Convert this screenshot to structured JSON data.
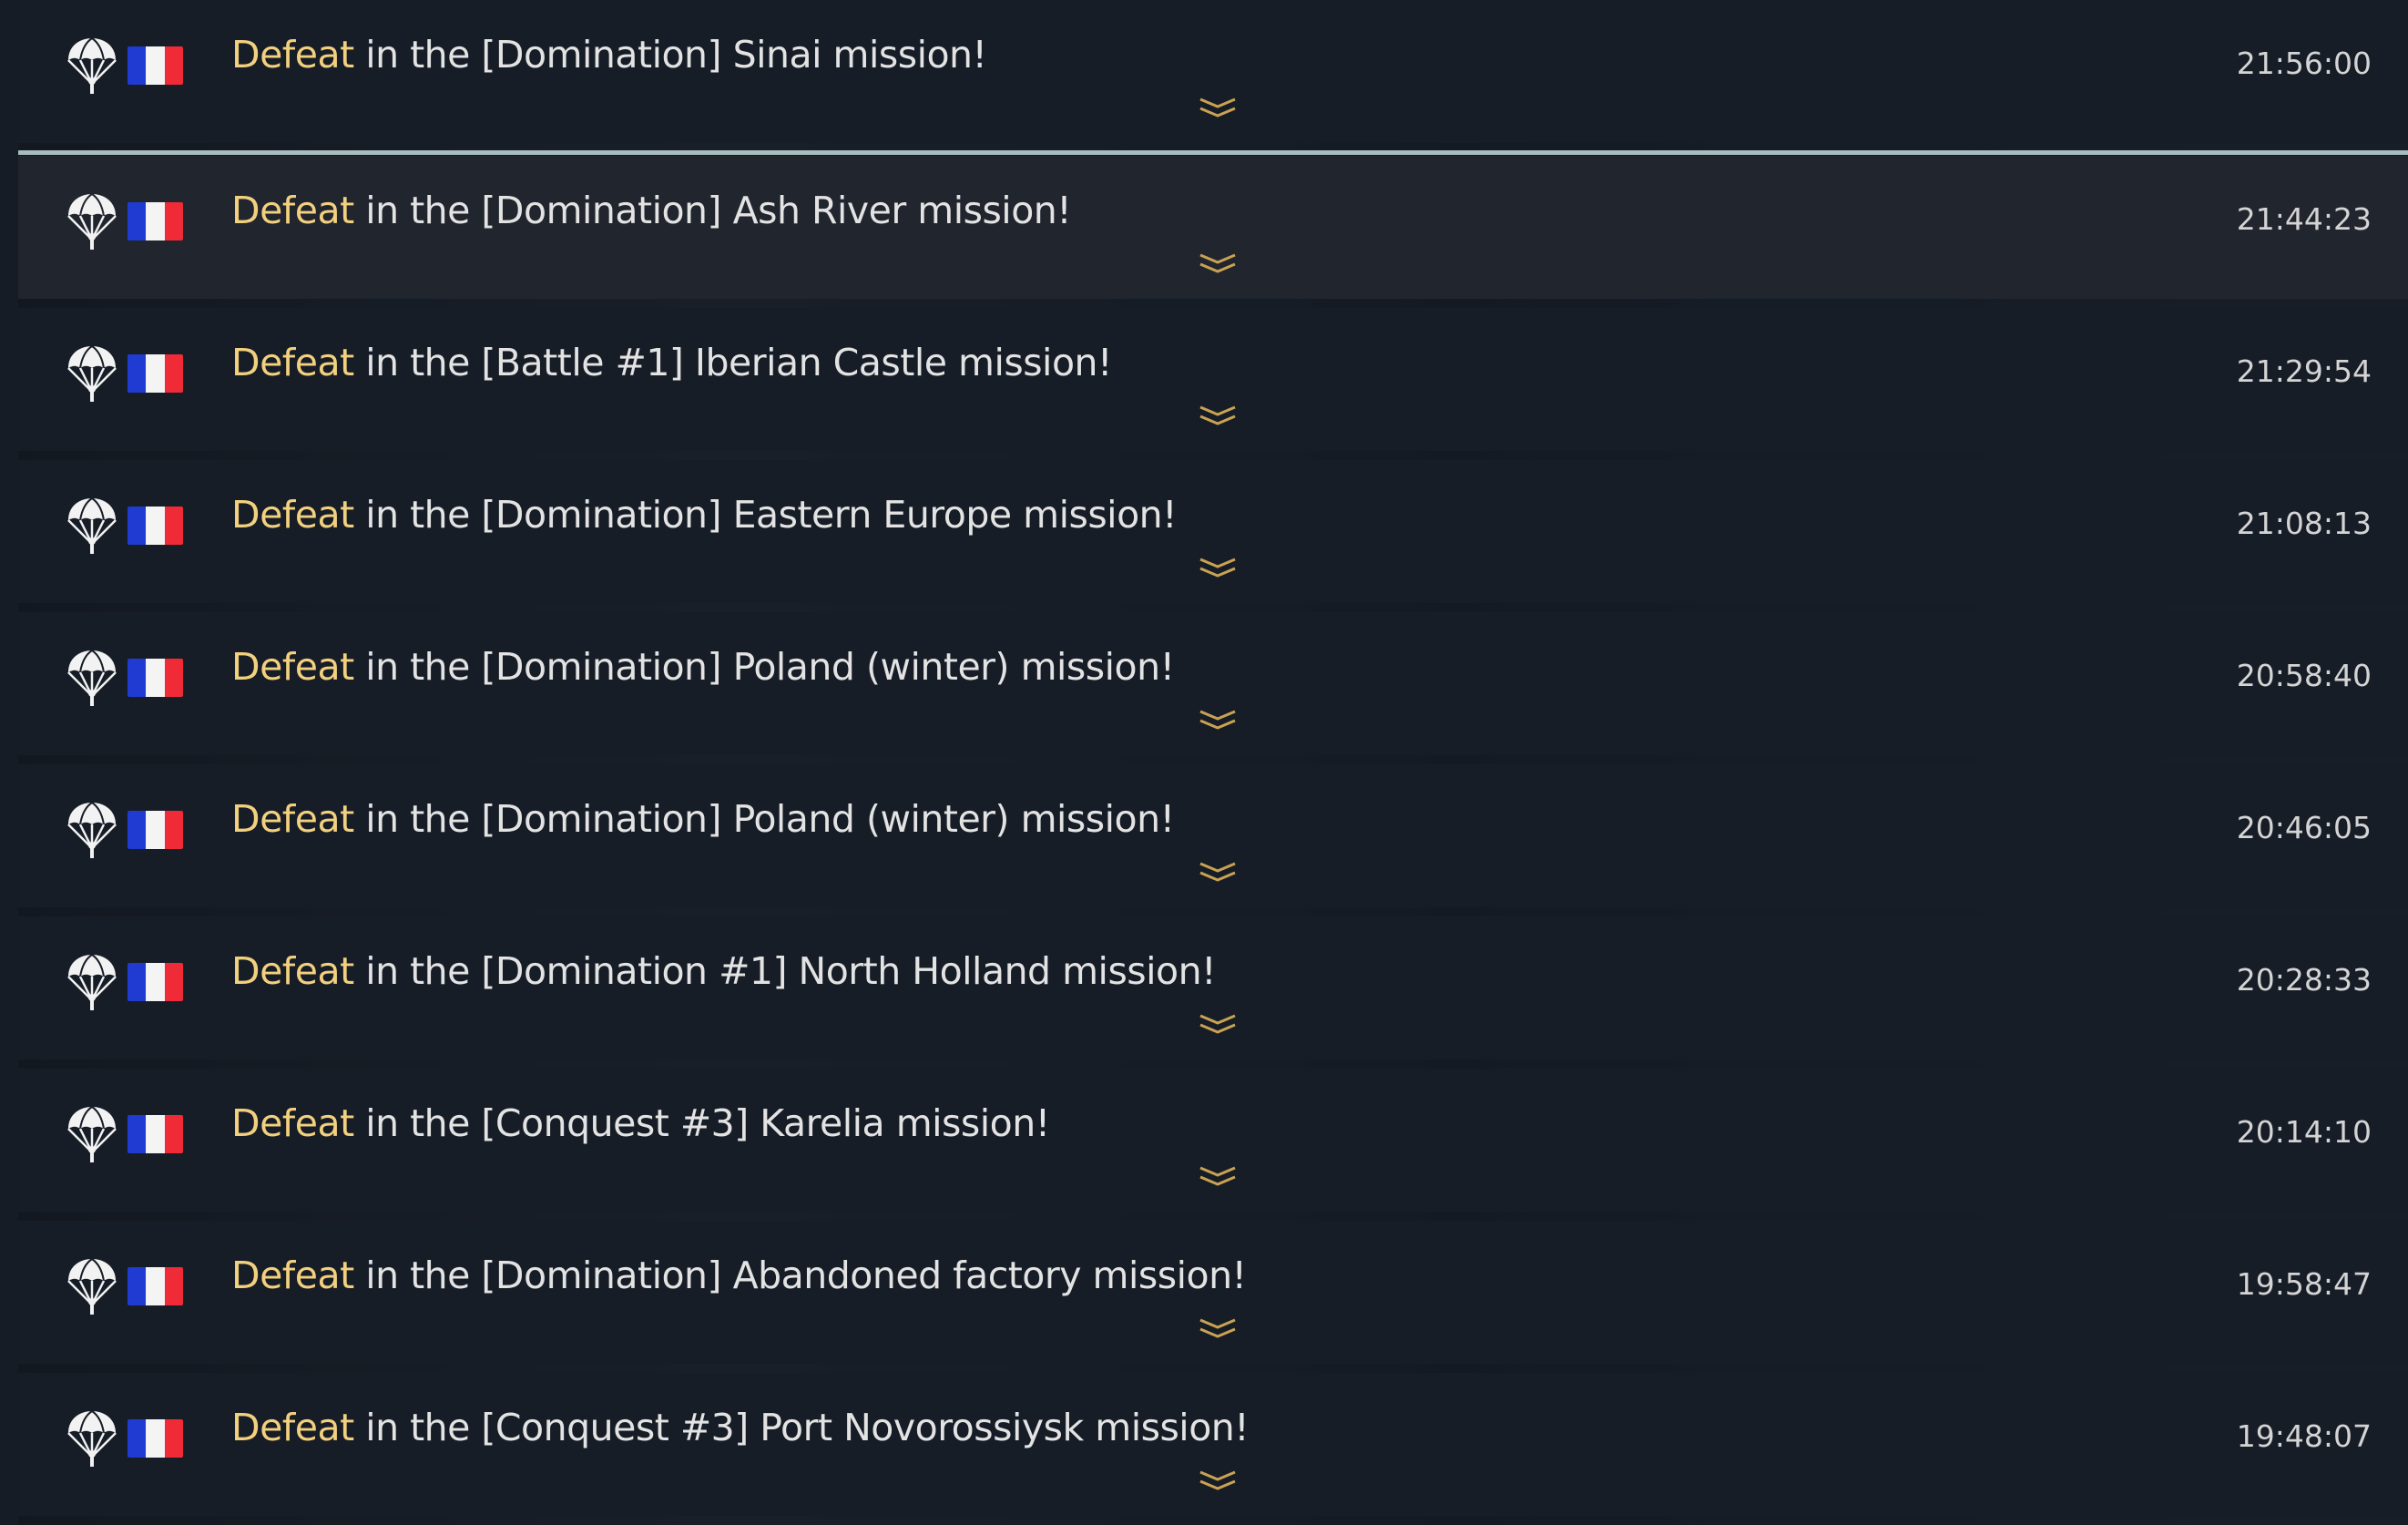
{
  "colors": {
    "background": "#161c26",
    "row_background": "#171d27",
    "selected_row_background": "#20252e",
    "selected_divider": "#a9bcbf",
    "result_text": "#f2d07e",
    "message_text": "#e3e3e3",
    "time_text": "#d4d4d4",
    "expand_chevron": "#c9a253",
    "flag_blue": "#1f3bd1",
    "flag_white": "#f4f4f4",
    "flag_red": "#ef2b37"
  },
  "icons": {
    "unit": "paratrooper-icon",
    "nation": "france-flag-icon",
    "expand": "double-chevron-down-icon"
  },
  "battles": [
    {
      "result": "Defeat",
      "text": " in the [Domination] Sinai mission!",
      "time": "21:56:00"
    },
    {
      "result": "Defeat",
      "text": " in the [Domination] Ash River mission!",
      "time": "21:44:23",
      "selected": true
    },
    {
      "result": "Defeat",
      "text": " in the [Battle #1] Iberian Castle mission!",
      "time": "21:29:54"
    },
    {
      "result": "Defeat",
      "text": " in the [Domination] Eastern Europe mission!",
      "time": "21:08:13"
    },
    {
      "result": "Defeat",
      "text": " in the [Domination] Poland (winter) mission!",
      "time": "20:58:40"
    },
    {
      "result": "Defeat",
      "text": " in the [Domination] Poland (winter) mission!",
      "time": "20:46:05"
    },
    {
      "result": "Defeat",
      "text": " in the [Domination #1] North Holland mission!",
      "time": "20:28:33"
    },
    {
      "result": "Defeat",
      "text": " in the [Conquest #3] Karelia mission!",
      "time": "20:14:10"
    },
    {
      "result": "Defeat",
      "text": " in the [Domination] Abandoned factory mission!",
      "time": "19:58:47"
    },
    {
      "result": "Defeat",
      "text": " in the [Conquest #3] Port Novorossiysk mission!",
      "time": "19:48:07"
    }
  ]
}
